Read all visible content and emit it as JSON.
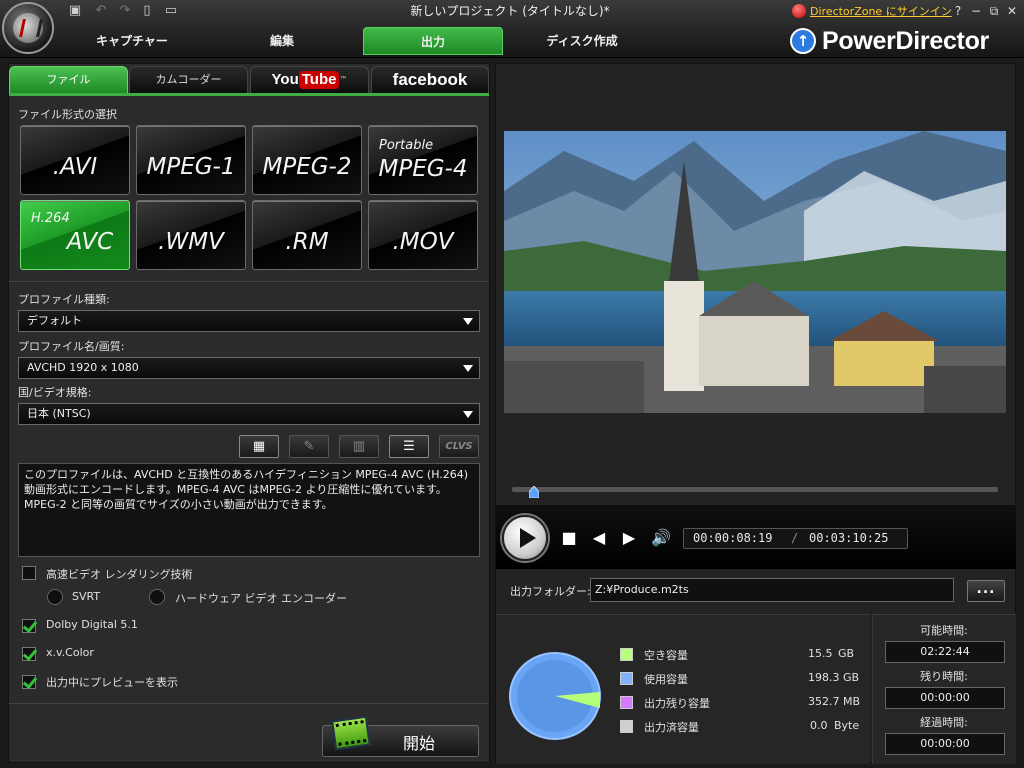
{
  "window": {
    "title": "新しいプロジェクト (タイトルなし)*",
    "directorzone_link": "DirectorZone にサインイン",
    "brand": "PowerDirector",
    "controls": {
      "help": "?",
      "minimize": "−",
      "restore": "⧉",
      "close": "✕"
    }
  },
  "nav_tabs": [
    {
      "label": "キャプチャー"
    },
    {
      "label": "編集"
    },
    {
      "label": "出力"
    },
    {
      "label": "ディスク作成"
    }
  ],
  "sub_tabs": {
    "file": "ファイル",
    "camcorder": "カムコーダー",
    "youtube_a": "You",
    "youtube_b": "Tube",
    "youtube_tm": "™",
    "facebook": "facebook"
  },
  "format_section_label": "ファイル形式の選択",
  "formats": [
    {
      "label": ".AVI",
      "small": ""
    },
    {
      "label": "MPEG-1",
      "small": ""
    },
    {
      "label": "MPEG-2",
      "small": ""
    },
    {
      "label": "MPEG-4",
      "small": "Portable"
    },
    {
      "label": "AVC",
      "small": "H.264"
    },
    {
      "label": ".WMV",
      "small": ""
    },
    {
      "label": ".RM",
      "small": ""
    },
    {
      "label": ".MOV",
      "small": ""
    }
  ],
  "selected_format": "AVC",
  "profile_type": {
    "label": "プロファイル種類:",
    "value": "デフォルト"
  },
  "profile_name": {
    "label": "プロファイル名/画質:",
    "value": "AVCHD 1920 x 1080"
  },
  "country": {
    "label": "国/ビデオ規格:",
    "value": "日本 (NTSC)"
  },
  "profile_toolbar": {
    "clvs": "CLVS"
  },
  "description": "このプロファイルは、AVCHD と互換性のあるハイデフィニション MPEG-4 AVC (H.264) 動画形式にエンコードします。MPEG-4 AVC はMPEG-2 より圧縮性に優れています。MPEG-2 と同等の画質でサイズの小さい動画が出力できます。",
  "options": {
    "fast_render": {
      "label": "高速ビデオ レンダリング技術",
      "checked": false
    },
    "svrt": {
      "label": "SVRT"
    },
    "hw_encoder": {
      "label": "ハードウェア ビデオ エンコーダー"
    },
    "dolby": {
      "label": "Dolby Digital 5.1",
      "checked": true
    },
    "xvcolor": {
      "label": "x.v.Color",
      "checked": true
    },
    "preview": {
      "label": "出力中にプレビューを表示",
      "checked": true
    }
  },
  "start_button": "開始",
  "playback": {
    "current_time": "00:00:08:19",
    "separator": "/",
    "total_time": "00:03:10:25",
    "position": 0.045
  },
  "output_folder": {
    "label": "出力フォルダー:",
    "value": "Z:¥Produce.m2ts",
    "browse": "..."
  },
  "disk": {
    "free": {
      "label": "空き容量",
      "value": "15.5",
      "unit": "GB",
      "color": "#b6ff7a"
    },
    "used": {
      "label": "使用容量",
      "value": "198.3",
      "unit": "GB",
      "color": "#7fb1ff"
    },
    "remaining_output": {
      "label": "出力残り容量",
      "value": "352.7",
      "unit": "MB",
      "color": "#d57aff"
    },
    "output_done": {
      "label": "出力済容量",
      "value": "0.0",
      "unit": "Byte",
      "color": "#cfcfcf"
    }
  },
  "times": {
    "available": {
      "label": "可能時間:",
      "value": "02:22:44"
    },
    "remaining": {
      "label": "残り時間:",
      "value": "00:00:00"
    },
    "elapsed": {
      "label": "経過時間:",
      "value": "00:00:00"
    }
  },
  "colors": {
    "accent_green": "#2a9a31",
    "pie_blue": "#6aa5f5",
    "pie_free": "#b6ff7a"
  }
}
